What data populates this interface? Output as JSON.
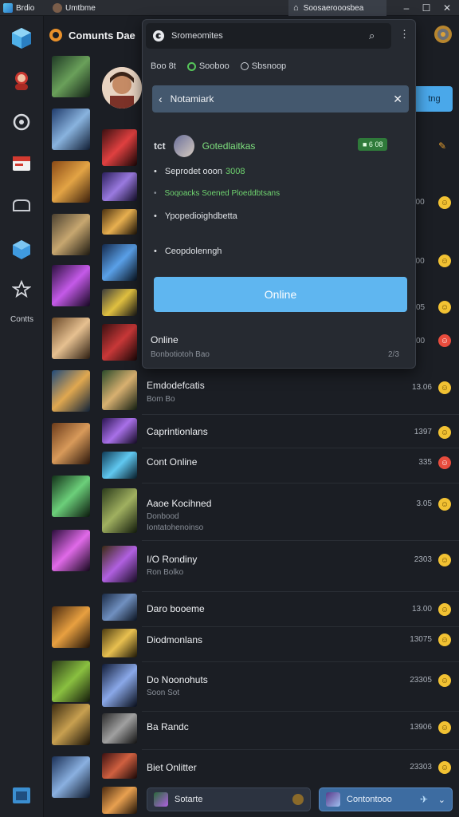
{
  "titlebar": {
    "app_name": "Brdio",
    "tab_label": "Umtbme",
    "active_tab": "Soosaerooosbea"
  },
  "header": {
    "title": "Comunts Dae"
  },
  "rail": {
    "label": "Contts"
  },
  "popup": {
    "search_placeholder": "Sromeomites",
    "filter_label": "Boo 8t",
    "filter_option_1": "Sooboo",
    "filter_option_2": "Sbsnoop",
    "header_title": "Notamiark",
    "user_prefix": "tct",
    "user_name": "Gotedlaitkas",
    "user_badge": "■ 6 08",
    "line_1": "Seprodet ooon",
    "line_1_highlight": "3008",
    "line_2": "Soqoacks Soened Ploeddbtsans",
    "line_3": "Ypopedioighdbetta",
    "line_4": "Ceopdolenngh",
    "online_button": "Online",
    "footer_title": "Online",
    "footer_sub": "Bonbotiotoh Bao",
    "footer_time": "2/3"
  },
  "peek_button": "tng",
  "rows": [
    {
      "title": "Emdodefcatis",
      "sub": "Bom Bo",
      "time": "13.06",
      "emoji": "yellow"
    },
    {
      "title": "Caprintionlans",
      "sub": "",
      "time": "1397",
      "emoji": "yellow"
    },
    {
      "title": "Cont Online",
      "sub": "",
      "time": "335",
      "emoji": "red"
    },
    {
      "title": "Aaoe Kocihned",
      "sub": "Donbood",
      "sub2": "Iontatohenoinso",
      "time": "3.05",
      "emoji": "yellow"
    },
    {
      "title": "I/O Rondiny",
      "sub": "Ron Bolko",
      "time": "2303",
      "emoji": "yellow"
    },
    {
      "title": "Daro booeme",
      "sub": "",
      "time": "13.00",
      "emoji": "yellow"
    },
    {
      "title": "Diodmonlans",
      "sub": "",
      "time": "13075",
      "emoji": "yellow"
    },
    {
      "title": "Do Noonohuts",
      "sub": "Soon Sot",
      "time": "23305",
      "emoji": "yellow"
    },
    {
      "title": "Ba Randc",
      "sub": "",
      "time": "13906",
      "emoji": "yellow"
    },
    {
      "title": "Biet Onlitter",
      "sub": "",
      "time": "23303",
      "emoji": "yellow"
    }
  ],
  "side_times": [
    "100",
    "100",
    "05",
    "00"
  ],
  "bottom": {
    "left_label": "Sotarte",
    "right_label": "Contontooo"
  }
}
